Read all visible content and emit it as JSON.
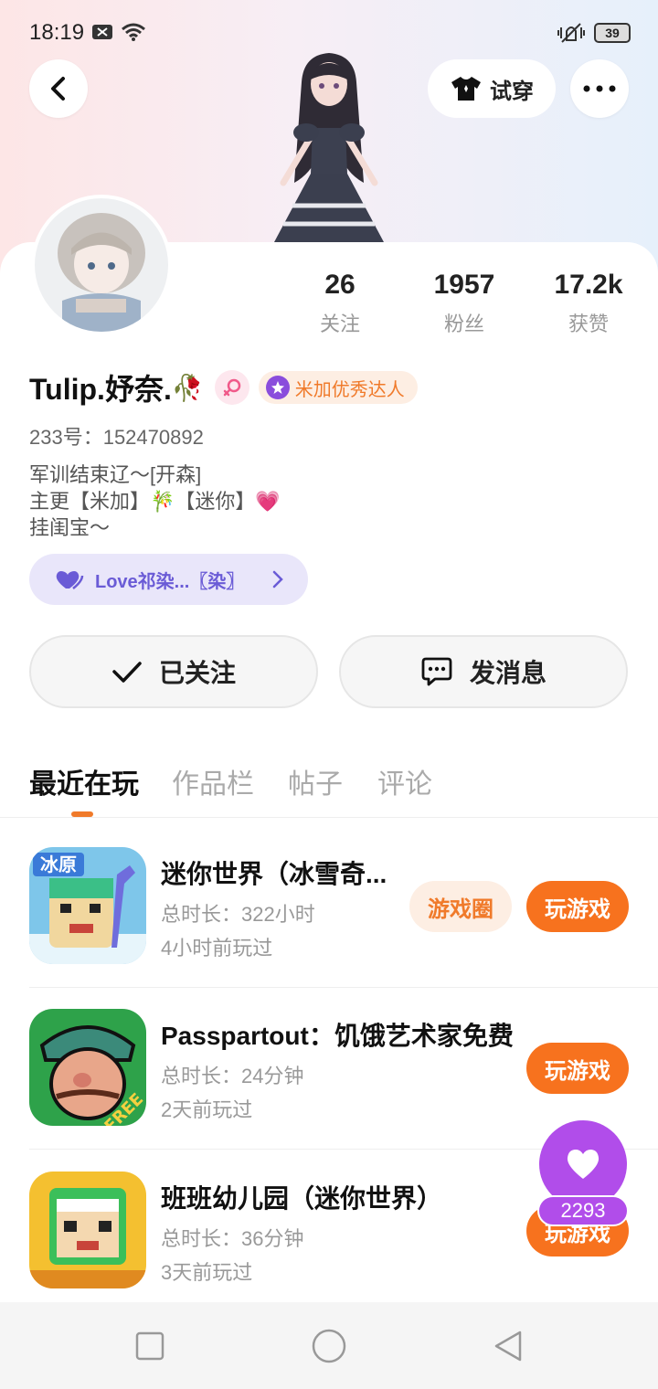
{
  "status": {
    "time": "18:19",
    "battery": "39"
  },
  "header": {
    "try_on_label": "试穿"
  },
  "profile": {
    "username": "Tulip.妤奈.",
    "username_emoji": "🥀",
    "talent_badge": "米加优秀达人",
    "uid_label": "233号：152470892",
    "bio": [
      "军训结束辽～[开森]",
      "主更【米加】🎋【迷你】💗",
      "挂闺宝～"
    ],
    "cp_label": "Love祁染...〖染〗"
  },
  "stats": [
    {
      "value": "26",
      "label": "关注"
    },
    {
      "value": "1957",
      "label": "粉丝"
    },
    {
      "value": "17.2k",
      "label": "获赞"
    }
  ],
  "actions": {
    "follow_label": "已关注",
    "message_label": "发消息"
  },
  "tabs": [
    "最近在玩",
    "作品栏",
    "帖子",
    "评论"
  ],
  "games": [
    {
      "title": "迷你世界（冰雪奇...",
      "duration": "总时长：322小时",
      "last_played": "4小时前玩过",
      "circle_label": "游戏圈",
      "play_label": "玩游戏",
      "icon_text": "冰原"
    },
    {
      "title": "Passpartout：饥饿艺术家免费",
      "duration": "总时长：24分钟",
      "last_played": "2天前玩过",
      "play_label": "玩游戏",
      "icon_text": "FREE"
    },
    {
      "title": "班班幼儿园（迷你世界）",
      "duration": "总时长：36分钟",
      "last_played": "3天前玩过",
      "play_label": "玩游戏"
    }
  ],
  "like": {
    "count": "2293"
  },
  "colors": {
    "accent": "#f7721e",
    "purple": "#b14dea",
    "cp": "#6a5bd6"
  }
}
